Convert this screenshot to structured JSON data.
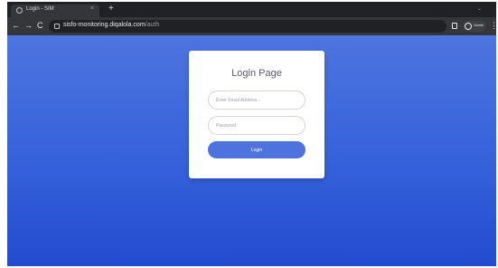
{
  "browser": {
    "tab": {
      "title": "Login - SIM",
      "close": "×"
    },
    "new_tab": "+",
    "tab_search": "⌄",
    "nav": {
      "back": "←",
      "forward": "→",
      "reload": "C"
    },
    "url": {
      "host": "sisfo-monitoring.diqalola.com",
      "path": "/auth"
    },
    "profile_label": "Guest",
    "menu": "⋮"
  },
  "login": {
    "title": "Login Page",
    "email_placeholder": "Enter Email Address...",
    "password_placeholder": "Password",
    "button_label": "Login"
  },
  "colors": {
    "page_gradient_top": "#4e74df",
    "page_gradient_bottom": "#224bcf",
    "primary_button": "#4e73df",
    "browser_chrome": "#35363a"
  }
}
